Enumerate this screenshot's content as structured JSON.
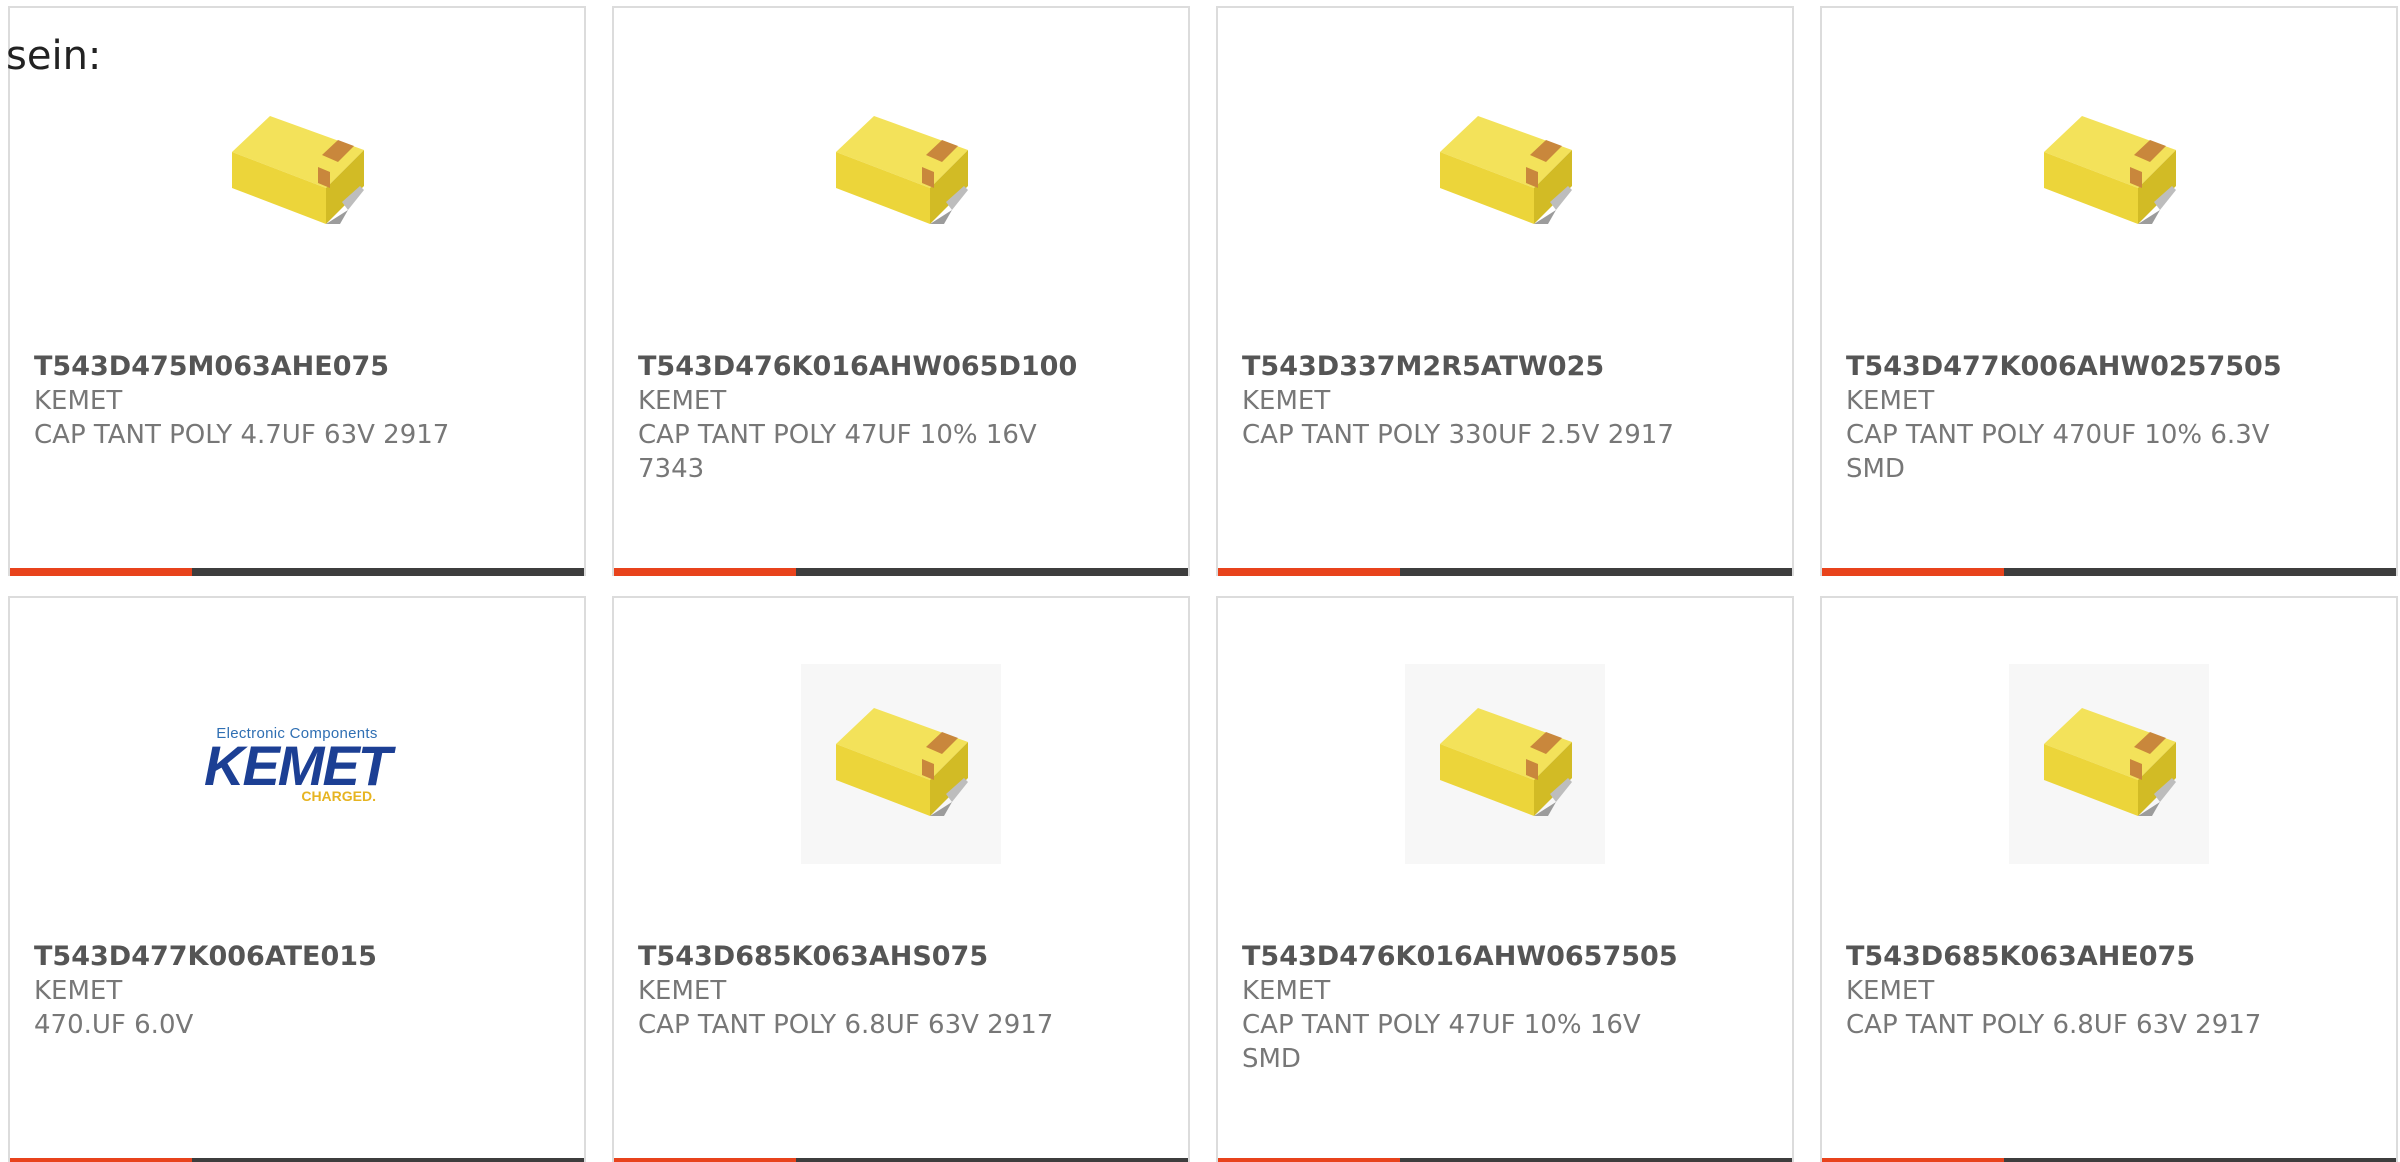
{
  "intro_text": "sein:",
  "colors": {
    "accent": "#e8431c",
    "bar": "#3d3d3d",
    "cap_body": "#ecd53a",
    "cap_top": "#f3e25a",
    "cap_side": "#d2bb25",
    "cap_marking": "#c9873c",
    "logo_blue": "#1c3f94",
    "logo_gold": "#e6b421"
  },
  "logo": {
    "tagline": "Electronic Components",
    "name": "KEMET",
    "slogan": "CHARGED."
  },
  "products": [
    {
      "part": "T543D475M063AHE075",
      "brand": "KEMET",
      "description": "CAP TANT POLY 4.7UF 63V 2917",
      "image": "capacitor-icon"
    },
    {
      "part": "T543D476K016AHW065D100",
      "brand": "KEMET",
      "description": "CAP TANT POLY 47UF 10% 16V 7343",
      "image": "capacitor-icon"
    },
    {
      "part": "T543D337M2R5ATW025",
      "brand": "KEMET",
      "description": "CAP TANT POLY 330UF 2.5V 2917",
      "image": "capacitor-icon"
    },
    {
      "part": "T543D477K006AHW0257505",
      "brand": "KEMET",
      "description": "CAP TANT POLY 470UF 10% 6.3V SMD",
      "image": "capacitor-icon"
    },
    {
      "part": "T543D477K006ATE015",
      "brand": "KEMET",
      "description": "470.UF 6.0V",
      "image": "kemet-logo"
    },
    {
      "part": "T543D685K063AHS075",
      "brand": "KEMET",
      "description": "CAP TANT POLY 6.8UF 63V 2917",
      "image": "capacitor-icon"
    },
    {
      "part": "T543D476K016AHW0657505",
      "brand": "KEMET",
      "description": "CAP TANT POLY 47UF 10% 16V SMD",
      "image": "capacitor-icon"
    },
    {
      "part": "T543D685K063AHE075",
      "brand": "KEMET",
      "description": "CAP TANT POLY 6.8UF 63V 2917",
      "image": "capacitor-icon"
    }
  ]
}
